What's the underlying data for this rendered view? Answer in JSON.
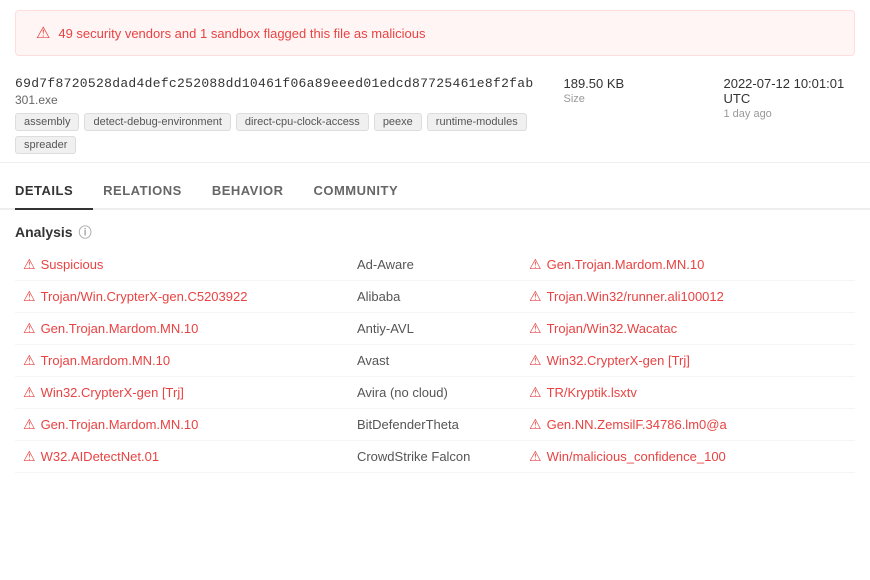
{
  "warning": {
    "text": "49 security vendors and 1 sandbox flagged this file as malicious"
  },
  "file": {
    "hash": "69d7f8720528dad4defc252088dd10461f06a89eeed01edcd87725461e8f2fab",
    "name": "301.exe",
    "size_value": "189.50 KB",
    "size_label": "Size",
    "date_value": "2022-07-12 10:01:01 UTC",
    "date_label": "1 day ago",
    "tags": [
      "assembly",
      "detect-debug-environment",
      "direct-cpu-clock-access",
      "peexe",
      "runtime-modules",
      "spreader"
    ]
  },
  "tabs": [
    {
      "label": "DETAILS",
      "active": false
    },
    {
      "label": "RELATIONS",
      "active": false
    },
    {
      "label": "BEHAVIOR",
      "active": false
    },
    {
      "label": "COMMUNITY",
      "active": false
    }
  ],
  "analysis": {
    "header": "Analysis",
    "rows": [
      {
        "detection1": "Suspicious",
        "vendor1": "Ad-Aware",
        "detection2": "Gen.Trojan.Mardom.MN.10",
        "has_icon1": true,
        "has_icon2": true
      },
      {
        "detection1": "Trojan/Win.CrypterX-gen.C5203922",
        "vendor1": "Alibaba",
        "detection2": "Trojan.Win32/runner.ali100012",
        "has_icon1": true,
        "has_icon2": true
      },
      {
        "detection1": "Gen.Trojan.Mardom.MN.10",
        "vendor1": "Antiy-AVL",
        "detection2": "Trojan/Win32.Wacatac",
        "has_icon1": true,
        "has_icon2": true
      },
      {
        "detection1": "Trojan.Mardom.MN.10",
        "vendor1": "Avast",
        "detection2": "Win32.CrypterX-gen [Trj]",
        "has_icon1": true,
        "has_icon2": true
      },
      {
        "detection1": "Win32.CrypterX-gen [Trj]",
        "vendor1": "Avira (no cloud)",
        "detection2": "TR/Kryptik.lsxtv",
        "has_icon1": true,
        "has_icon2": true
      },
      {
        "detection1": "Gen.Trojan.Mardom.MN.10",
        "vendor1": "BitDefenderTheta",
        "detection2": "Gen.NN.ZemsilF.34786.lm0@a",
        "has_icon1": true,
        "has_icon2": true
      },
      {
        "detection1": "W32.AIDetectNet.01",
        "vendor1": "CrowdStrike Falcon",
        "detection2": "Win/malicious_confidence_100",
        "has_icon1": true,
        "has_icon2": true
      }
    ]
  }
}
